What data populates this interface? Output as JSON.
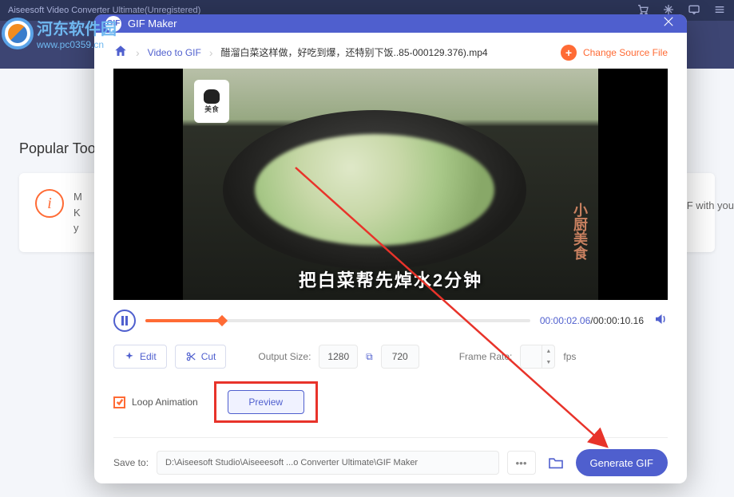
{
  "titlebar": {
    "title": "Aiseesoft Video Converter Ultimate(Unregistered)"
  },
  "watermark": {
    "cn": "河东软件园",
    "url": "www.pc0359.cn"
  },
  "background": {
    "popular": "Popular Tool",
    "card_lines": "M\nK\ny",
    "right_text": "F with you"
  },
  "modal": {
    "title": "GIF Maker",
    "breadcrumb": {
      "video_to_gif": "Video to GIF",
      "filename": "醋溜白菜这样做，好吃到爆，还特别下饭..85-000129.376).mp4"
    },
    "change_source": "Change Source File",
    "video": {
      "chef_label": "美食",
      "side_label": "小厨美食",
      "caption": "把白菜帮先焯水2分钟"
    },
    "controls": {
      "time_current": "00:00:02.06",
      "time_total": "00:00:10.16"
    },
    "toolbar": {
      "edit": "Edit",
      "cut": "Cut",
      "output_size_label": "Output Size:",
      "width": "1280",
      "height": "720",
      "frame_rate_label": "Frame Rate:",
      "fps_value": "",
      "fps_unit": "fps"
    },
    "row2": {
      "loop": "Loop Animation",
      "preview": "Preview"
    },
    "footer": {
      "save_to": "Save to:",
      "path": "D:\\Aiseesoft Studio\\Aiseeesoft ...o Converter Ultimate\\GIF Maker",
      "generate": "Generate GIF"
    }
  }
}
